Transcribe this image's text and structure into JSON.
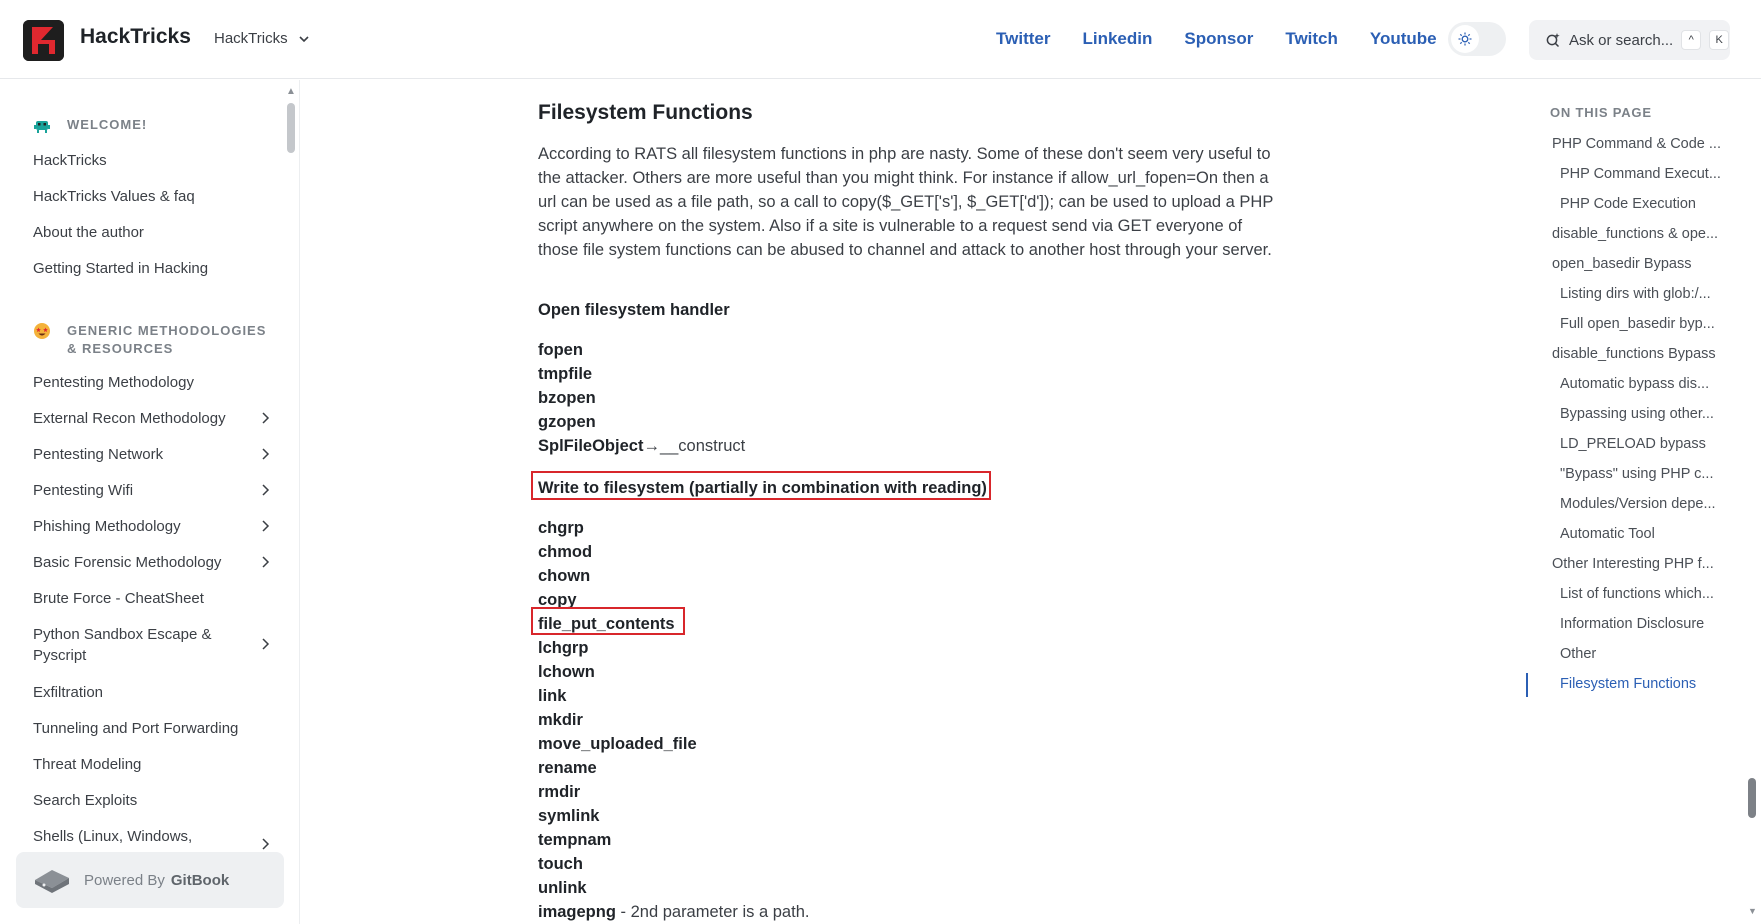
{
  "header": {
    "site_title": "HackTricks",
    "space_switcher": "HackTricks",
    "nav_links": [
      "Twitter",
      "Linkedin",
      "Sponsor",
      "Twitch",
      "Youtube"
    ],
    "search_placeholder": "Ask or search...",
    "search_shortcut": [
      "^",
      "K"
    ]
  },
  "sidebar": {
    "section_welcome": "WELCOME!",
    "welcome_items": [
      "HackTricks",
      "HackTricks Values & faq",
      "About the author",
      "Getting Started in Hacking"
    ],
    "section_generic": "GENERIC METHODOLOGIES & RESOURCES",
    "generic_items": [
      {
        "label": "Pentesting Methodology",
        "expandable": false
      },
      {
        "label": "External Recon Methodology",
        "expandable": true
      },
      {
        "label": "Pentesting Network",
        "expandable": true
      },
      {
        "label": "Pentesting Wifi",
        "expandable": true
      },
      {
        "label": "Phishing Methodology",
        "expandable": true
      },
      {
        "label": "Basic Forensic Methodology",
        "expandable": true
      },
      {
        "label": "Brute Force - CheatSheet",
        "expandable": false
      },
      {
        "label": "Python Sandbox Escape & Pyscript",
        "expandable": true
      },
      {
        "label": "Exfiltration",
        "expandable": false
      },
      {
        "label": "Tunneling and Port Forwarding",
        "expandable": false
      },
      {
        "label": "Threat Modeling",
        "expandable": false
      },
      {
        "label": "Search Exploits",
        "expandable": false
      },
      {
        "label": "Shells (Linux, Windows,",
        "expandable": true
      }
    ],
    "powered_by": "Powered By",
    "powered_by_brand": "GitBook"
  },
  "main": {
    "heading": "Filesystem Functions",
    "paragraph": "According to RATS all filesystem functions in php are nasty. Some of these don't seem very useful to the attacker. Others are more useful than you might think. For instance if allow_url_fopen=On then a url can be used as a file path, so a call to copy($_GET['s'], $_GET['d']); can be used to upload a PHP script anywhere on the system. Also if a site is vulnerable to a request send via GET everyone of those file system functions can be abused to channel and attack to another host through your server.",
    "open_handler_title": "Open filesystem handler",
    "open_handler_funcs": [
      "fopen",
      "tmpfile",
      "bzopen",
      "gzopen"
    ],
    "splfile_bold": "SplFileObject",
    "splfile_rest": "→__construct",
    "write_title": "Write to filesystem (partially in combination with reading)",
    "write_funcs": [
      "chgrp",
      "chmod",
      "chown",
      "copy",
      "file_put_contents",
      "lchgrp",
      "lchown",
      "link",
      "mkdir",
      "move_uploaded_file",
      "rename",
      "rmdir",
      "symlink",
      "tempnam",
      "touch",
      "unlink"
    ],
    "imagepng_bold": "imagepng",
    "imagepng_rest": " - 2nd parameter is a path."
  },
  "toc": {
    "heading": "ON THIS PAGE",
    "items": [
      {
        "label": "PHP Command & Code ...",
        "level": 1
      },
      {
        "label": "PHP Command Execut...",
        "level": 2
      },
      {
        "label": "PHP Code Execution",
        "level": 2
      },
      {
        "label": "disable_functions & ope...",
        "level": 1
      },
      {
        "label": "open_basedir Bypass",
        "level": 1
      },
      {
        "label": "Listing dirs with glob:/...",
        "level": 2
      },
      {
        "label": "Full open_basedir byp...",
        "level": 2
      },
      {
        "label": "disable_functions Bypass",
        "level": 1
      },
      {
        "label": "Automatic bypass dis...",
        "level": 2
      },
      {
        "label": "Bypassing using other...",
        "level": 2
      },
      {
        "label": "LD_PRELOAD bypass",
        "level": 2
      },
      {
        "label": "\"Bypass\" using PHP c...",
        "level": 2
      },
      {
        "label": "Modules/Version depe...",
        "level": 2
      },
      {
        "label": "Automatic Tool",
        "level": 2
      },
      {
        "label": "Other Interesting PHP f...",
        "level": 1
      },
      {
        "label": "List of functions which...",
        "level": 2
      },
      {
        "label": "Information Disclosure",
        "level": 2
      },
      {
        "label": "Other",
        "level": 2
      },
      {
        "label": "Filesystem Functions",
        "level": 2,
        "active": true
      }
    ]
  },
  "colors": {
    "link": "#2b5fb4",
    "highlight_box": "#d8262b",
    "logo_bg": "#1e1e1e",
    "logo_accent": "#e0282f"
  }
}
